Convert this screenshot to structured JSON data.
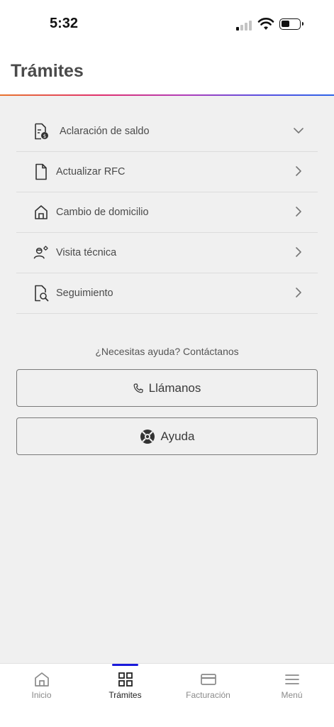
{
  "status_bar": {
    "time": "5:32"
  },
  "header": {
    "title": "Trámites"
  },
  "procedures": [
    {
      "label": "Aclaración de saldo",
      "icon": "document-dollar-icon",
      "expanded": true
    },
    {
      "label": "Actualizar RFC",
      "icon": "document-icon",
      "expanded": false
    },
    {
      "label": "Cambio de domicilio",
      "icon": "house-icon",
      "expanded": false
    },
    {
      "label": "Visita técnica",
      "icon": "technician-icon",
      "expanded": false
    },
    {
      "label": "Seguimiento",
      "icon": "document-search-icon",
      "expanded": false
    }
  ],
  "help": {
    "text": "¿Necesitas ayuda? Contáctanos",
    "call_label": "Llámanos",
    "call_icon": "phone-icon",
    "help_label": "Ayuda",
    "help_icon": "lifebuoy-icon"
  },
  "tabbar": {
    "tabs": [
      {
        "label": "Inicio",
        "icon": "home-icon",
        "active": false
      },
      {
        "label": "Trámites",
        "icon": "grid-icon",
        "active": true
      },
      {
        "label": "Facturación",
        "icon": "credit-card-icon",
        "active": false
      },
      {
        "label": "Menú",
        "icon": "hamburger-menu-icon",
        "active": false
      }
    ]
  },
  "colors": {
    "active_tab_indicator": "#1a1adb",
    "accent_gradient": [
      "#e8732c",
      "#e0306e",
      "#b23db8",
      "#2b63e8"
    ]
  }
}
